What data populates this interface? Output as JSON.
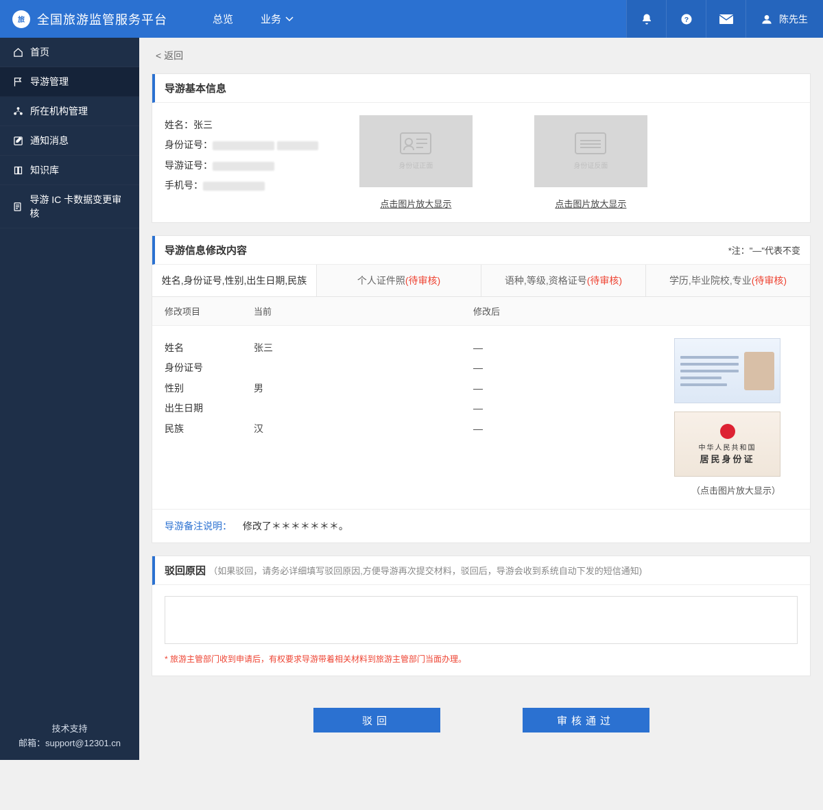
{
  "header": {
    "title": "全国旅游监管服务平台",
    "nav": {
      "overview": "总览",
      "business": "业务"
    },
    "user": "陈先生"
  },
  "sidebar": {
    "items": [
      {
        "label": "首页"
      },
      {
        "label": "导游管理"
      },
      {
        "label": "所在机构管理"
      },
      {
        "label": "通知消息"
      },
      {
        "label": "知识库"
      },
      {
        "label": "导游 IC 卡数据变更审核"
      }
    ],
    "support_title": "技术支持",
    "support_email": "邮箱：support@12301.cn"
  },
  "back_label": "返回",
  "basic": {
    "title": "导游基本信息",
    "name_label": "姓名：",
    "name_value": "张三",
    "id_label": "身份证号：",
    "guide_label": "导游证号：",
    "phone_label": "手机号：",
    "front_caption": "身份证正面",
    "back_caption": "身份证反面",
    "enlarge": "点击图片放大显示"
  },
  "mod": {
    "title": "导游信息修改内容",
    "note": "*注：\"—\"代表不变",
    "tabs": [
      {
        "label": "姓名,身份证号,性别,出生日期,民族",
        "pending": ""
      },
      {
        "label": "个人证件照",
        "pending": "(待审核)"
      },
      {
        "label": "语种,等级,资格证号",
        "pending": "(待审核)"
      },
      {
        "label": "学历,毕业院校,专业",
        "pending": "(待审核)"
      }
    ],
    "head": {
      "c1": "修改项目",
      "c2": "当前",
      "c3": "修改后"
    },
    "rows": [
      {
        "name": "姓名",
        "current": "张三",
        "after": "—"
      },
      {
        "name": "身份证号",
        "current": "",
        "after": "—",
        "blur": true
      },
      {
        "name": "性别",
        "current": "男",
        "after": "—"
      },
      {
        "name": "出生日期",
        "current": "",
        "after": "—",
        "blur": true
      },
      {
        "name": "民族",
        "current": "汉",
        "after": "—"
      }
    ],
    "id_back_t1": "中华人民共和国",
    "id_back_t2": "居民身份证",
    "enlarge_hint": "（点击图片放大显示）",
    "remark_label": "导游备注说明：",
    "remark_value": "修改了＊＊＊＊＊＊＊。"
  },
  "reject": {
    "title": "驳回原因",
    "hint": "（如果驳回，请务必详细填写驳回原因,方便导游再次提交材料，驳回后，导游会收到系统自动下发的短信通知)",
    "note": "* 旅游主管部门收到申请后，有权要求导游带着相关材料到旅游主管部门当面办理。"
  },
  "actions": {
    "reject": "驳回",
    "approve": "审核通过"
  }
}
